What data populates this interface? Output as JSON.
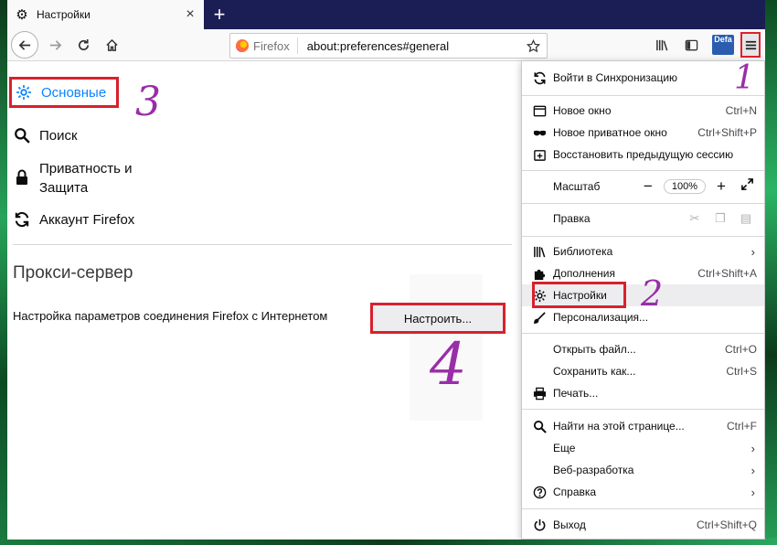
{
  "tab": {
    "title": "Настройки",
    "close": "×",
    "new_tab": "+"
  },
  "toolbar": {
    "url_brand": "Firefox",
    "url_text": "about:preferences#general",
    "ext_badge": "Defa"
  },
  "sidebar": {
    "items": [
      {
        "label": "Основные",
        "icon": "gear-icon"
      },
      {
        "label": "Поиск",
        "icon": "search-icon"
      },
      {
        "label": "Приватность и Защита",
        "line1": "Приватность и",
        "line2": "Защита",
        "icon": "lock-icon"
      },
      {
        "label": "Аккаунт Firefox",
        "icon": "sync-icon"
      }
    ]
  },
  "proxy": {
    "title": "Прокси-сервер",
    "description": "Настройка параметров соединения Firefox с Интернетом",
    "button": "Настроить..."
  },
  "menu": {
    "sync": "Войти в Синхронизацию",
    "new_window": {
      "label": "Новое окно",
      "shortcut": "Ctrl+N"
    },
    "private_window": {
      "label": "Новое приватное окно",
      "shortcut": "Ctrl+Shift+P"
    },
    "restore": "Восстановить предыдущую сессию",
    "zoom": {
      "label": "Масштаб",
      "minus": "−",
      "value": "100%",
      "plus": "+"
    },
    "edit": "Правка",
    "library": "Библиотека",
    "addons": {
      "label": "Дополнения",
      "shortcut": "Ctrl+Shift+A"
    },
    "settings": "Настройки",
    "customize": "Персонализация...",
    "open_file": {
      "label": "Открыть файл...",
      "shortcut": "Ctrl+O"
    },
    "save_as": {
      "label": "Сохранить как...",
      "shortcut": "Ctrl+S"
    },
    "print": "Печать...",
    "find": {
      "label": "Найти на этой странице...",
      "shortcut": "Ctrl+F"
    },
    "more": "Еще",
    "web_dev": "Веб-разработка",
    "help": "Справка",
    "exit": {
      "label": "Выход",
      "shortcut": "Ctrl+Shift+Q"
    },
    "arrow": "›"
  },
  "annotations": {
    "n1": "1",
    "n2": "2",
    "n3": "3",
    "n4": "4"
  },
  "colors": {
    "accent": "#0a84ff",
    "highlight_box": "#d7212d",
    "handwriting": "#9a2da8",
    "tabstrip": "#1b1e54"
  }
}
